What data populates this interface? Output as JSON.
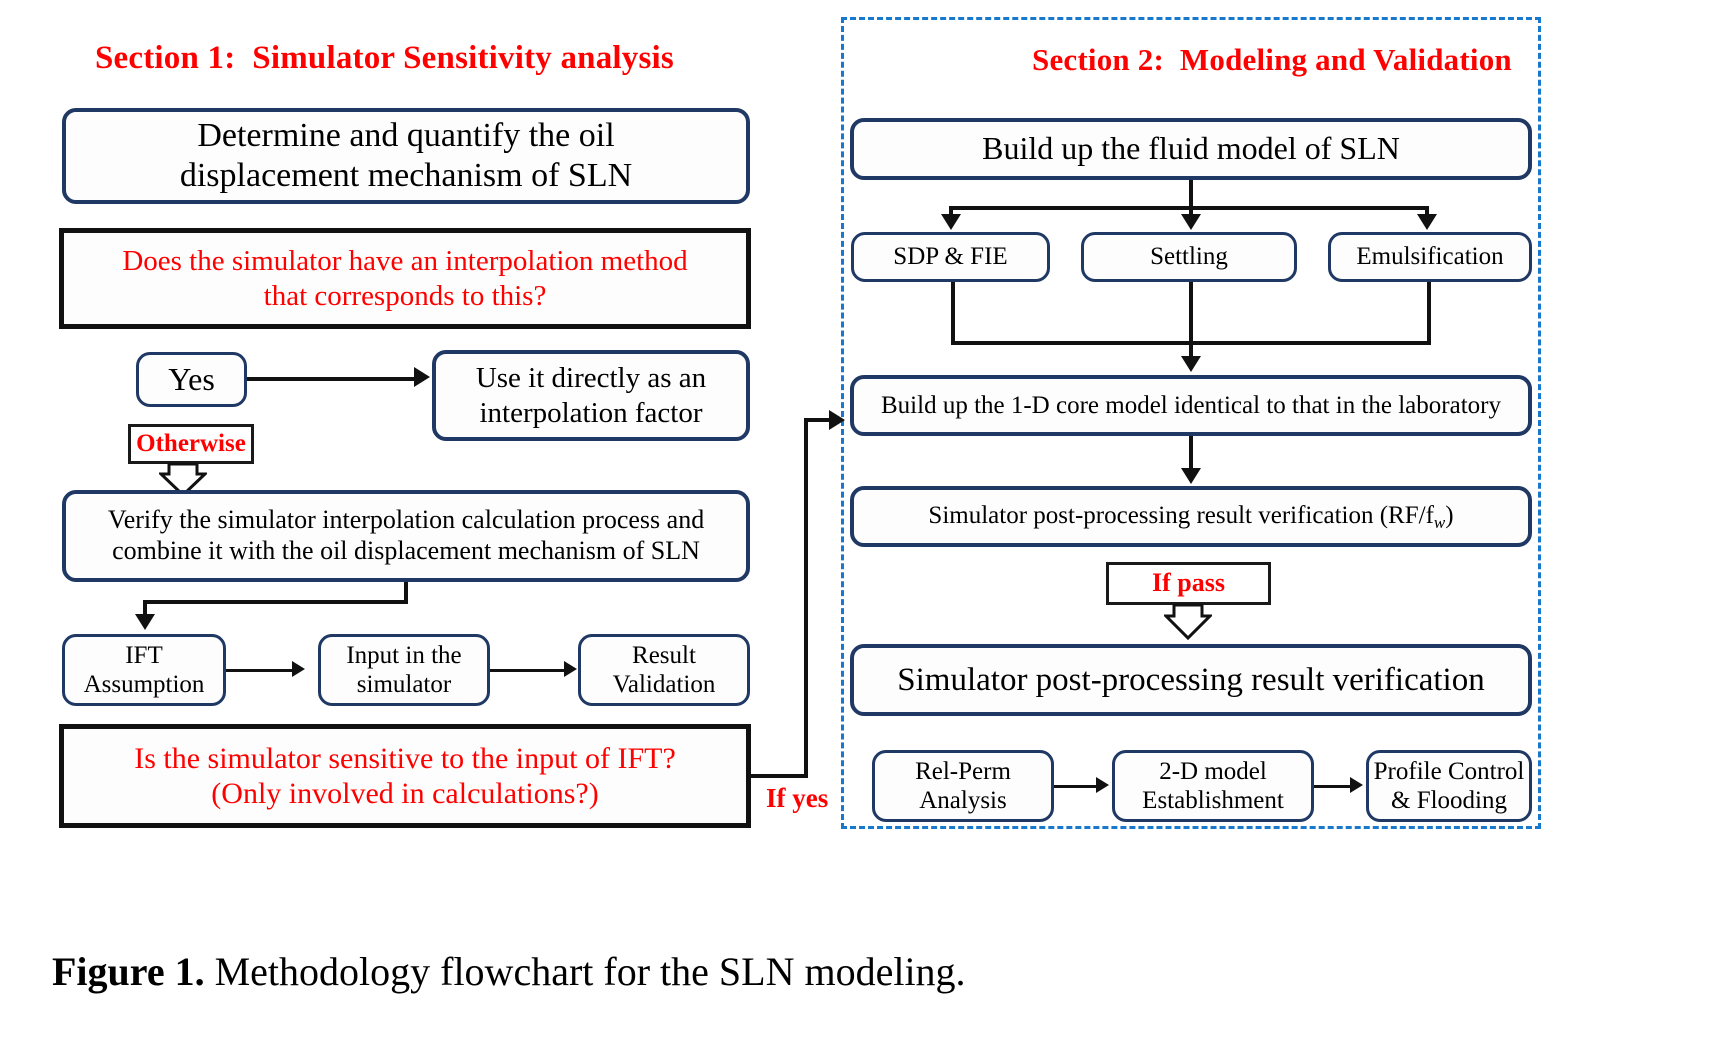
{
  "figure": {
    "caption_prefix": "Figure 1.",
    "caption_text": " Methodology flowchart for the SLN modeling."
  },
  "colors": {
    "section_title_red": "#ff0000",
    "box_border_navy": "#1f3864",
    "decision_border_black": "#111111",
    "panel_dash_blue": "#1878ce"
  },
  "section1": {
    "title": "Section 1:  Simulator Sensitivity analysis",
    "nodes": {
      "determine": "Determine and quantify the oil\ndisplacement mechanism of SLN",
      "decision_interpolation": "Does the simulator  have an interpolation  method\nthat corresponds  to this?",
      "yes": "Yes",
      "use_directly": "Use it directly as an\ninterpolation factor",
      "otherwise": "Otherwise",
      "verify": "Verify the simulator interpolation calculation process and\ncombine it with the oil displacement mechanism of SLN",
      "ift_assumption": "IFT\nAssumption",
      "input_simulator": "Input in the\nsimulator",
      "result_validation": "Result\nValidation",
      "decision_sensitive": "Is the simulator  sensitive to the input of IFT?\n(Only involved  in calculations?)"
    },
    "edge_labels": {
      "if_yes": "If yes"
    }
  },
  "section2": {
    "title": "Section 2:  Modeling and Validation",
    "nodes": {
      "build_fluid": "Build up the fluid model of SLN",
      "sdp_fie": "SDP & FIE",
      "settling": "Settling",
      "emulsification": "Emulsification",
      "build_core": "Build up the 1-D core model identical to that in the laboratory",
      "post_proc_rf": "Simulator post-processing result verification (RF/f",
      "post_proc_rf_sub": "w",
      "post_proc_rf_tail": ")",
      "if_pass": "If pass",
      "post_proc_verification": "Simulator  post-processing  result  verification",
      "rel_perm": "Rel-Perm\nAnalysis",
      "model_2d": "2-D model\nEstablishment",
      "profile_control": "Profile Control\n& Flooding"
    }
  }
}
